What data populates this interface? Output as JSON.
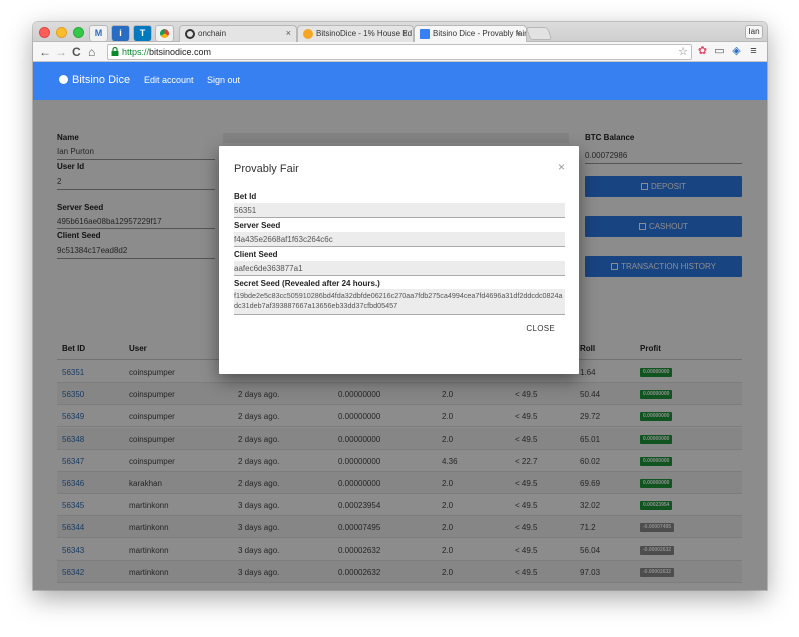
{
  "browser": {
    "pinned_tabs": [
      "M",
      "i",
      "T"
    ],
    "tabs": [
      {
        "title": "onchain",
        "fav_color": "#333333",
        "active": false
      },
      {
        "title": "BitsinoDice - 1% House Ed",
        "fav_color": "#f5a623",
        "active": false
      },
      {
        "title": "Bitsino Dice - Provably fair",
        "fav_color": "#3680f2",
        "active": true
      }
    ],
    "tab_close": "×",
    "profile": "Ian",
    "url_scheme": "https://",
    "url_host": "bitsinodice.com",
    "back": "←",
    "forward": "→",
    "reload": "C",
    "home": "⌂",
    "star": "☆",
    "menu": "≡"
  },
  "navbar": {
    "brand": "Bitsino Dice",
    "links": [
      "Edit account",
      "Sign out"
    ],
    "color": "#3680f2"
  },
  "profile": {
    "name_label": "Name",
    "name": "Ian Purton",
    "userid_label": "User Id",
    "userid": "2",
    "server_seed_label": "Server Seed",
    "server_seed": "495b616ae08ba12957229f17",
    "client_seed_label": "Client Seed",
    "client_seed": "9c51384c17ead8d2"
  },
  "balance": {
    "label": "BTC Balance",
    "value": "0.00072986",
    "buttons": [
      "DEPOSIT",
      "CASHOUT",
      "TRANSACTION HISTORY"
    ]
  },
  "modal": {
    "title": "Provably Fair",
    "close_icon": "×",
    "bet_id_label": "Bet Id",
    "bet_id": "56351",
    "server_seed_label": "Server Seed",
    "server_seed": "f4a435e2668af1f63c264c6c",
    "client_seed_label": "Client Seed",
    "client_seed": "aafec6de363877a1",
    "secret_label": "Secret Seed (Revealed after 24 hours.)",
    "secret": "f19bde2e5c83cc505910286bd4fda32dbfde06216c270aa7fdb275ca4994cea7fd4696a31df2ddcdc0824adc31deb7af393887667a13656eb33dd37cfbd05457",
    "close_button": "CLOSE"
  },
  "table": {
    "headers": [
      "Bet ID",
      "User",
      "",
      "",
      "",
      "",
      "Roll",
      "Profit"
    ],
    "rows": [
      [
        "56351",
        "coinspumper",
        "",
        "",
        "",
        "",
        "1.64",
        "0.00000000",
        "win"
      ],
      [
        "56350",
        "coinspumper",
        "2 days ago.",
        "0.00000000",
        "2.0",
        "< 49.5",
        "50.44",
        "0.00000000",
        "win"
      ],
      [
        "56349",
        "coinspumper",
        "2 days ago.",
        "0.00000000",
        "2.0",
        "< 49.5",
        "29.72",
        "0.00000000",
        "win"
      ],
      [
        "56348",
        "coinspumper",
        "2 days ago.",
        "0.00000000",
        "2.0",
        "< 49.5",
        "65.01",
        "0.00000000",
        "win"
      ],
      [
        "56347",
        "coinspumper",
        "2 days ago.",
        "0.00000000",
        "4.36",
        "< 22.7",
        "60.02",
        "0.00000000",
        "win"
      ],
      [
        "56346",
        "karakhan",
        "2 days ago.",
        "0.00000000",
        "2.0",
        "< 49.5",
        "69.69",
        "0.00000000",
        "win"
      ],
      [
        "56345",
        "martinkonn",
        "3 days ago.",
        "0.00023954",
        "2.0",
        "< 49.5",
        "32.02",
        "0.00023954",
        "win"
      ],
      [
        "56344",
        "martinkonn",
        "3 days ago.",
        "0.00007495",
        "2.0",
        "< 49.5",
        "71.2",
        "-0.00007495",
        "loss"
      ],
      [
        "56343",
        "martinkonn",
        "3 days ago.",
        "0.00002632",
        "2.0",
        "< 49.5",
        "56.04",
        "-0.00002632",
        "loss"
      ],
      [
        "56342",
        "martinkonn",
        "3 days ago.",
        "0.00002632",
        "2.0",
        "< 49.5",
        "97.03",
        "-0.00002632",
        "loss"
      ]
    ],
    "win_color": "#1e9b3b",
    "loss_color": "#8c8c8c"
  }
}
